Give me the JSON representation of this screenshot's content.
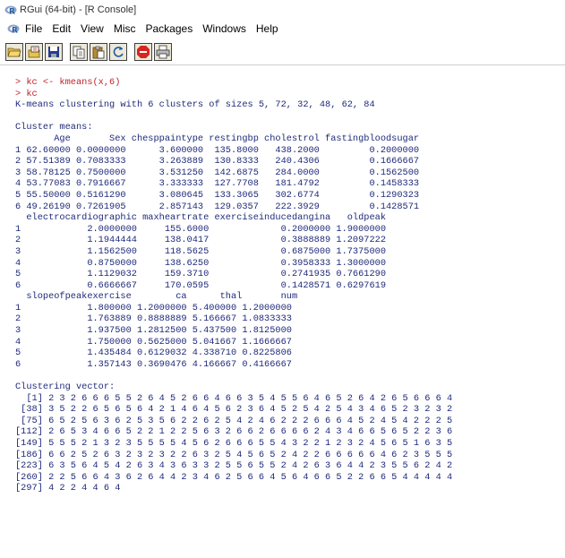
{
  "window": {
    "title": "RGui (64-bit) - [R Console]"
  },
  "menu": {
    "items": [
      "File",
      "Edit",
      "View",
      "Misc",
      "Packages",
      "Windows",
      "Help"
    ]
  },
  "toolbar": {
    "buttons": [
      "open-script",
      "load-workspace",
      "save-workspace",
      "copy",
      "paste",
      "copy-paste",
      "stop",
      "print"
    ]
  },
  "colors": {
    "input": "#c0232c",
    "output": "#1f2a7a"
  },
  "console": {
    "lines": [
      {
        "type": "cmd",
        "text": "> kc <- kmeans(x,6)"
      },
      {
        "type": "cmd",
        "text": "> kc"
      },
      {
        "type": "out",
        "text": "K-means clustering with 6 clusters of sizes 5, 72, 32, 48, 62, 84"
      },
      {
        "type": "blank",
        "text": ""
      },
      {
        "type": "out",
        "text": "Cluster means:"
      },
      {
        "type": "out",
        "text": "       Age       Sex chesppaintype restingbp cholestrol fastingbloodsugar"
      },
      {
        "type": "out",
        "text": "1 62.60000 0.0000000      3.600000  135.8000   438.2000         0.2000000"
      },
      {
        "type": "out",
        "text": "2 57.51389 0.7083333      3.263889  130.8333   240.4306         0.1666667"
      },
      {
        "type": "out",
        "text": "3 58.78125 0.7500000      3.531250  142.6875   284.0000         0.1562500"
      },
      {
        "type": "out",
        "text": "4 53.77083 0.7916667      3.333333  127.7708   181.4792         0.1458333"
      },
      {
        "type": "out",
        "text": "5 55.50000 0.5161290      3.080645  133.3065   302.6774         0.1290323"
      },
      {
        "type": "out",
        "text": "6 49.26190 0.7261905      2.857143  129.0357   222.3929         0.1428571"
      },
      {
        "type": "out",
        "text": "  electrocardiographic maxheartrate exerciseinducedangina   oldpeak"
      },
      {
        "type": "out",
        "text": "1            2.0000000     155.6000             0.2000000 1.9000000"
      },
      {
        "type": "out",
        "text": "2            1.1944444     138.0417             0.3888889 1.2097222"
      },
      {
        "type": "out",
        "text": "3            1.1562500     118.5625             0.6875000 1.7375000"
      },
      {
        "type": "out",
        "text": "4            0.8750000     138.6250             0.3958333 1.3000000"
      },
      {
        "type": "out",
        "text": "5            1.1129032     159.3710             0.2741935 0.7661290"
      },
      {
        "type": "out",
        "text": "6            0.6666667     170.0595             0.1428571 0.6297619"
      },
      {
        "type": "out",
        "text": "  slopeofpeakexercise        ca      thal       num"
      },
      {
        "type": "out",
        "text": "1            1.800000 1.2000000 5.400000 1.2000000"
      },
      {
        "type": "out",
        "text": "2            1.763889 0.8888889 5.166667 1.0833333"
      },
      {
        "type": "out",
        "text": "3            1.937500 1.2812500 5.437500 1.8125000"
      },
      {
        "type": "out",
        "text": "4            1.750000 0.5625000 5.041667 1.1666667"
      },
      {
        "type": "out",
        "text": "5            1.435484 0.6129032 4.338710 0.8225806"
      },
      {
        "type": "out",
        "text": "6            1.357143 0.3690476 4.166667 0.4166667"
      },
      {
        "type": "blank",
        "text": ""
      },
      {
        "type": "out",
        "text": "Clustering vector:"
      },
      {
        "type": "out",
        "text": "  [1] 2 3 2 6 6 6 5 5 2 6 4 5 2 6 6 4 6 6 3 5 4 5 5 6 4 6 5 2 6 4 2 6 5 6 6 6 4"
      },
      {
        "type": "out",
        "text": " [38] 3 5 2 2 6 5 6 5 6 4 2 1 4 6 4 5 6 2 3 6 4 5 2 5 4 2 5 4 3 4 6 5 2 3 2 3 2"
      },
      {
        "type": "out",
        "text": " [75] 6 5 2 5 6 3 6 2 5 3 5 6 2 2 6 2 5 4 2 4 6 2 2 2 6 6 6 4 5 2 4 5 4 2 2 2 5"
      },
      {
        "type": "out",
        "text": "[112] 2 6 5 3 4 6 6 5 2 2 1 2 2 5 6 3 2 6 6 2 6 6 6 6 2 4 3 4 6 6 5 6 5 2 2 3 6"
      },
      {
        "type": "out",
        "text": "[149] 5 5 5 2 1 3 2 3 5 5 5 5 4 5 6 2 6 6 6 5 5 4 3 2 2 1 2 3 2 4 5 6 5 1 6 3 5"
      },
      {
        "type": "out",
        "text": "[186] 6 6 2 5 2 6 3 2 3 2 3 2 2 6 3 2 5 4 5 6 5 2 4 2 2 6 6 6 6 6 4 6 2 3 5 5 5"
      },
      {
        "type": "out",
        "text": "[223] 6 3 5 6 4 5 4 2 6 3 4 3 6 3 3 2 5 5 6 5 5 2 4 2 6 3 6 4 4 2 3 5 5 6 2 4 2"
      },
      {
        "type": "out",
        "text": "[260] 2 2 5 6 6 4 3 6 2 6 4 4 2 3 4 6 2 5 6 6 4 5 6 4 6 6 5 2 2 6 6 5 4 4 4 4 4"
      },
      {
        "type": "out",
        "text": "[297] 4 2 2 4 4 6 4"
      }
    ]
  }
}
